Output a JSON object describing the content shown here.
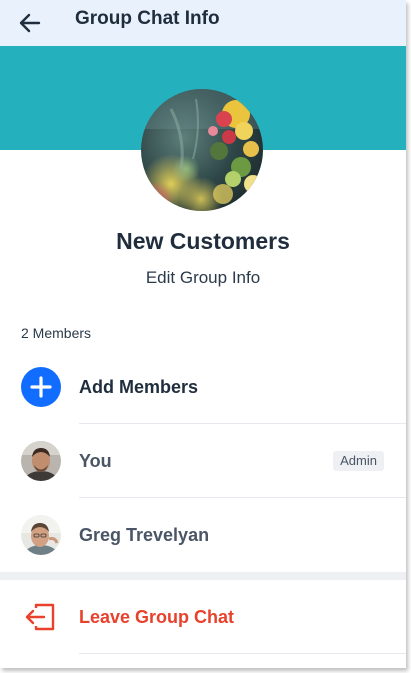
{
  "header": {
    "title": "Group Chat Info",
    "background": "#e9f2fc"
  },
  "banner": {
    "color": "#25b0bd"
  },
  "group": {
    "name": "New Customers",
    "edit_label": "Edit Group Info"
  },
  "members": {
    "count_label": "2 Members",
    "add_label": "Add Members",
    "list": [
      {
        "name": "You",
        "badge": "Admin"
      },
      {
        "name": "Greg Trevelyan"
      }
    ]
  },
  "actions": {
    "leave_label": "Leave Group Chat"
  },
  "colors": {
    "accent": "#116dff",
    "danger": "#e8412c",
    "text": "#1f2d3d"
  },
  "icons": {
    "back": "arrow-left-icon",
    "add": "plus-icon",
    "leave": "exit-icon"
  }
}
